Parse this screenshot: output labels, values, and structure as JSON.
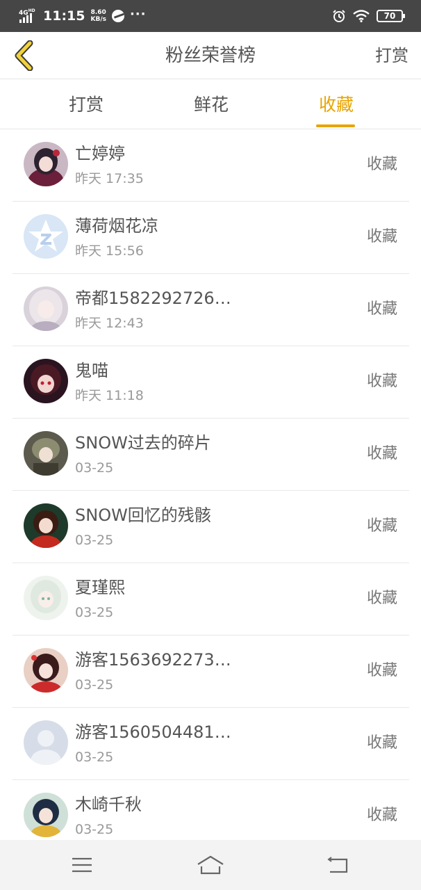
{
  "status_bar": {
    "network": "4G",
    "network_sup": "HD",
    "time": "11:15",
    "speed_value": "8.60",
    "speed_unit": "KB/s",
    "more": "···",
    "battery": "70"
  },
  "header": {
    "title": "粉丝荣誉榜",
    "action_label": "打赏"
  },
  "tabs": [
    {
      "label": "打赏",
      "active": false
    },
    {
      "label": "鲜花",
      "active": false
    },
    {
      "label": "收藏",
      "active": true
    }
  ],
  "accent_color": "#e8a400",
  "list": [
    {
      "name": "亡婷婷",
      "time": "昨天 17:35",
      "action": "收藏",
      "avatar": "anime-girl-avatar"
    },
    {
      "name": "薄荷烟花凉",
      "time": "昨天 15:56",
      "action": "收藏",
      "avatar": "default-star-avatar"
    },
    {
      "name": "帝都1582292726…",
      "time": "昨天 12:43",
      "action": "收藏",
      "avatar": "anime-girl-avatar"
    },
    {
      "name": "鬼喵",
      "time": "昨天 11:18",
      "action": "收藏",
      "avatar": "anime-girl-avatar"
    },
    {
      "name": "SNOW过去的碎片",
      "time": "03-25",
      "action": "收藏",
      "avatar": "anime-girl-avatar"
    },
    {
      "name": "SNOW回忆的残骸",
      "time": "03-25",
      "action": "收藏",
      "avatar": "anime-girl-avatar"
    },
    {
      "name": "夏瑾熙",
      "time": "03-25",
      "action": "收藏",
      "avatar": "anime-girl-avatar"
    },
    {
      "name": "游客1563692273…",
      "time": "03-25",
      "action": "收藏",
      "avatar": "anime-girl-avatar"
    },
    {
      "name": "游客1560504481…",
      "time": "03-25",
      "action": "收藏",
      "avatar": "default-person-avatar"
    },
    {
      "name": "木崎千秋",
      "time": "03-25",
      "action": "收藏",
      "avatar": "anime-girl-avatar"
    }
  ]
}
